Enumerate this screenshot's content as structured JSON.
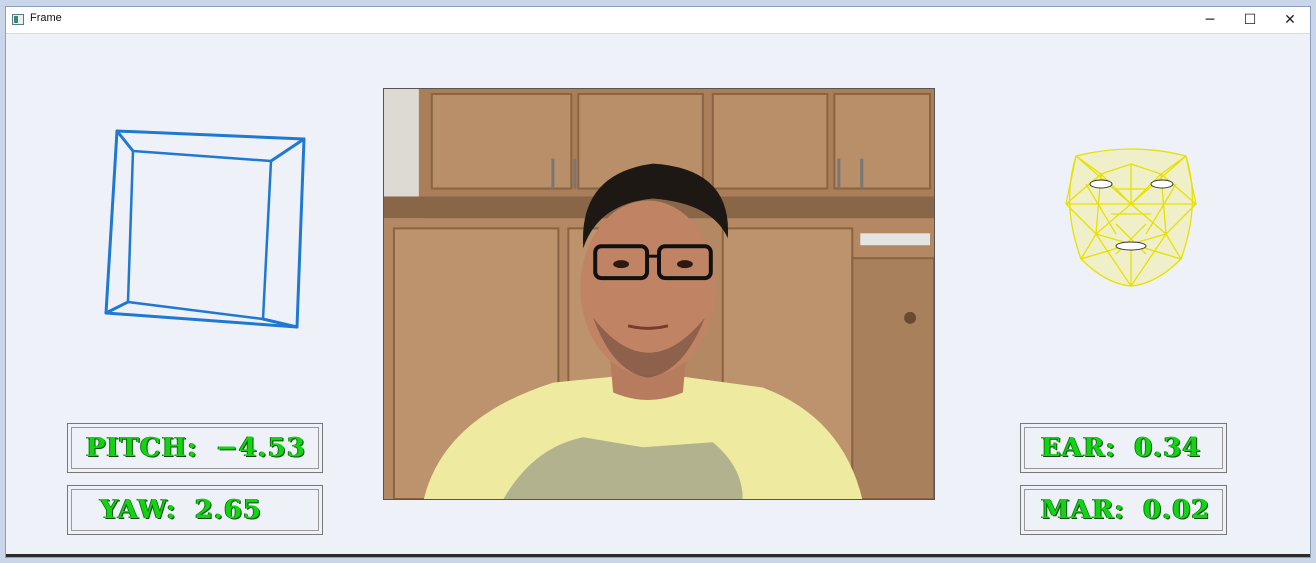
{
  "window": {
    "title": "Frame",
    "minimize_glyph": "─",
    "maximize_glyph": "☐",
    "close_glyph": "✕"
  },
  "icons": {
    "app": "app-icon",
    "minimize": "minimize-icon",
    "maximize": "maximize-icon",
    "close": "close-icon"
  },
  "colors": {
    "cube_stroke": "#1f78d1",
    "mesh_stroke": "#e8e000",
    "stat_text": "#12d412",
    "window_bg": "#eef2f8"
  },
  "stats": {
    "pitch": {
      "label": "PITCH:",
      "value": "−4.53"
    },
    "yaw": {
      "label": "YAW:",
      "value": "2.65"
    },
    "ear": {
      "label": "EAR:",
      "value": "0.34"
    },
    "mar": {
      "label": "MAR:",
      "value": "0.02"
    }
  }
}
